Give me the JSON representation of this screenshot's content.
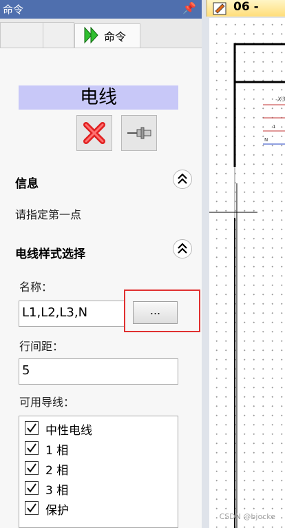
{
  "panel": {
    "title": "命令",
    "tab_label": "命令",
    "heading": "电线",
    "sections": {
      "info_title": "信息",
      "info_text": "请指定第一点",
      "style_title": "电线样式选择"
    },
    "name_label": "名称：",
    "name_value": "L1,L2,L3,N",
    "browse_label": "...",
    "spacing_label": "行间距：",
    "spacing_value": "5",
    "available_label": "可用导线：",
    "wires": [
      {
        "label": "中性电线",
        "checked": true
      },
      {
        "label": "1 相",
        "checked": true
      },
      {
        "label": "2 相",
        "checked": true
      },
      {
        "label": "3 相",
        "checked": true
      },
      {
        "label": "保护",
        "checked": true
      }
    ]
  },
  "canvas": {
    "doc_tab_label": "06 -",
    "labels": {
      "x": "-X3",
      "one": "1",
      "n": "N"
    }
  },
  "watermark": "CSDN @bjocke",
  "colors": {
    "accent": "#4f6fae",
    "heading_bg": "#c8c8f8",
    "highlight": "#e03030",
    "cancel": "#e02020"
  }
}
